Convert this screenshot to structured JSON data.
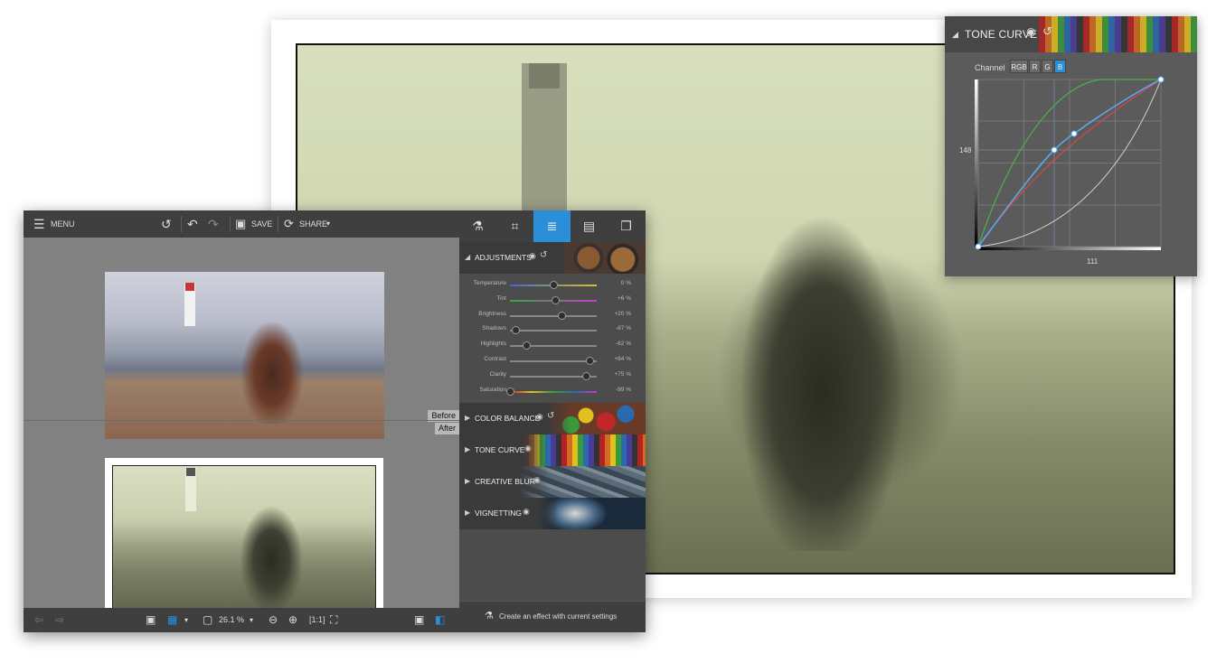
{
  "toolbar": {
    "menu_label": "MENU",
    "save_label": "SAVE",
    "share_label": "SHARE",
    "share_caret": "▾"
  },
  "canvas": {
    "before_label": "Before",
    "after_label": "After"
  },
  "statusbar": {
    "zoom_value": "26.1 %",
    "zoom_caret": "▾"
  },
  "right_panel": {
    "tabs": [
      {
        "icon": "flask-icon",
        "glyph": "⚗",
        "active": false
      },
      {
        "icon": "crop-icon",
        "glyph": "⌗",
        "active": false
      },
      {
        "icon": "sliders-icon",
        "glyph": "≣",
        "active": true
      },
      {
        "icon": "stamp-icon",
        "glyph": "▤",
        "active": false
      },
      {
        "icon": "layers-icon",
        "glyph": "❐",
        "active": false
      }
    ],
    "adjustments_title": "ADJUSTMENTS",
    "sliders": [
      {
        "label": "Temperature",
        "value": "0 %",
        "pos": 0.5
      },
      {
        "label": "Tint",
        "value": "+6 %",
        "pos": 0.53
      },
      {
        "label": "Brightness",
        "value": "+20 %",
        "pos": 0.6
      },
      {
        "label": "Shadows",
        "value": "-87 %",
        "pos": 0.07
      },
      {
        "label": "Highlights",
        "value": "-62 %",
        "pos": 0.19
      },
      {
        "label": "Contrast",
        "value": "+84 %",
        "pos": 0.92
      },
      {
        "label": "Clarity",
        "value": "+75 %",
        "pos": 0.88
      },
      {
        "label": "Saturation",
        "value": "-99 %",
        "pos": 0.01
      }
    ],
    "sections": [
      {
        "title": "COLOR BALANCE"
      },
      {
        "title": "TONE CURVE"
      },
      {
        "title": "CREATIVE BLUR"
      },
      {
        "title": "VIGNETTING"
      }
    ],
    "create_effect_label": "Create an effect with current settings"
  },
  "tone_curve": {
    "title": "TONE CURVE",
    "channel_label": "Channel",
    "channels": [
      "RGB",
      "R",
      "G",
      "B"
    ],
    "active_channel": "B",
    "input_value": "111",
    "output_value": "148"
  },
  "colors": {
    "accent": "#2a8fd8",
    "panel_dark": "#3f3f3f",
    "curve_red": "#d24a4a",
    "curve_green": "#4db04d",
    "curve_blue": "#5ea6ee"
  }
}
